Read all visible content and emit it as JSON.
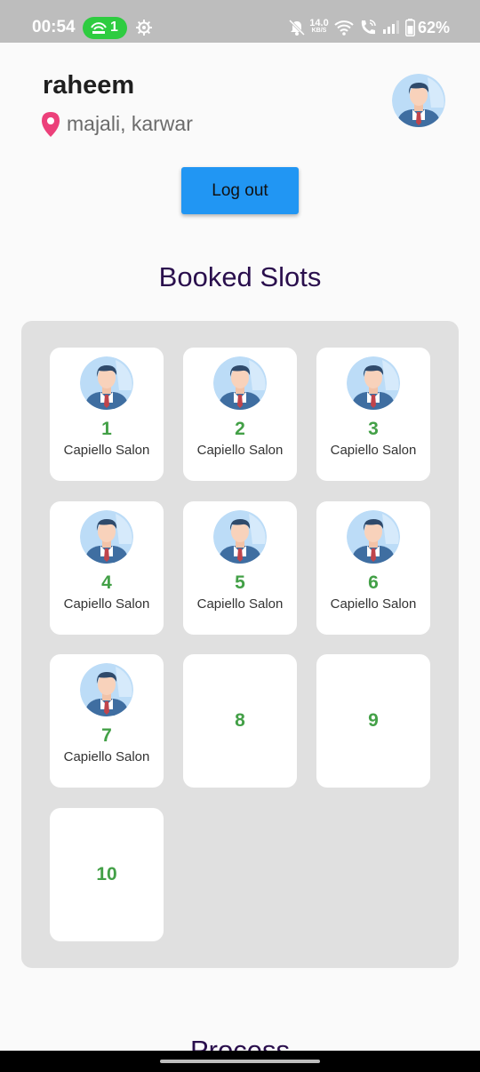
{
  "status_bar": {
    "time": "00:54",
    "hotspot_count": "1",
    "net_speed_value": "14.0",
    "net_speed_unit": "KB/S",
    "battery": "62%"
  },
  "profile": {
    "name": "raheem",
    "location": "majali, karwar",
    "avatar_icon": "businessman-avatar-icon"
  },
  "logout_label": "Log out",
  "booked_title": "Booked Slots",
  "process_title": "Process",
  "slots": [
    {
      "number": "1",
      "salon": "Capiello Salon",
      "booked": true
    },
    {
      "number": "2",
      "salon": "Capiello Salon",
      "booked": true
    },
    {
      "number": "3",
      "salon": "Capiello Salon",
      "booked": true
    },
    {
      "number": "4",
      "salon": "Capiello Salon",
      "booked": true
    },
    {
      "number": "5",
      "salon": "Capiello Salon",
      "booked": true
    },
    {
      "number": "6",
      "salon": "Capiello Salon",
      "booked": true
    },
    {
      "number": "7",
      "salon": "Capiello Salon",
      "booked": true
    },
    {
      "number": "8",
      "salon": "",
      "booked": false
    },
    {
      "number": "9",
      "salon": "",
      "booked": false
    },
    {
      "number": "10",
      "salon": "",
      "booked": false
    }
  ],
  "colors": {
    "accent": "#2196f3",
    "slot_number": "#43a047",
    "title": "#2a0f4d",
    "location_pin": "#ec407a"
  }
}
